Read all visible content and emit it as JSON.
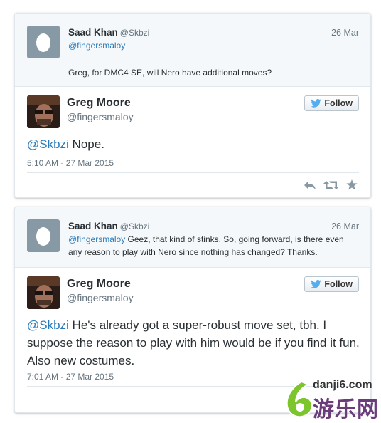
{
  "tweet1": {
    "parent": {
      "name": "Saad Khan",
      "handle": "@Skbzi",
      "date": "26 Mar",
      "reply_to": "@fingersmaloy",
      "text": "Greg, for DMC4 SE, will Nero have additional moves?"
    },
    "main": {
      "name": "Greg Moore",
      "handle": "@fingersmaloy",
      "follow_label": "Follow",
      "mention": "@Skbzi",
      "text": " Nope.",
      "timestamp": "5:10 AM - 27 Mar 2015"
    }
  },
  "tweet2": {
    "parent": {
      "name": "Saad Khan",
      "handle": "@Skbzi",
      "date": "26 Mar",
      "mention": "@fingersmaloy",
      "text": " Geez, that kind of stinks.  So, going forward, is there even any reason to play with Nero since nothing has changed?  Thanks."
    },
    "main": {
      "name": "Greg Moore",
      "handle": "@fingersmaloy",
      "follow_label": "Follow",
      "mention": "@Skbzi",
      "text": " He's already got a super-robust move set, tbh. I suppose the reason to play with him would be if you find it fun. Also new costumes.",
      "timestamp": "7:01 AM - 27 Mar 2015"
    }
  },
  "watermark": {
    "url": "danji6.com",
    "brand": "游乐网"
  },
  "colors": {
    "link": "#2b7bb9",
    "muted": "#66757f",
    "egg_bg": "#8899a6",
    "watermark_green": "#7cc52a"
  }
}
